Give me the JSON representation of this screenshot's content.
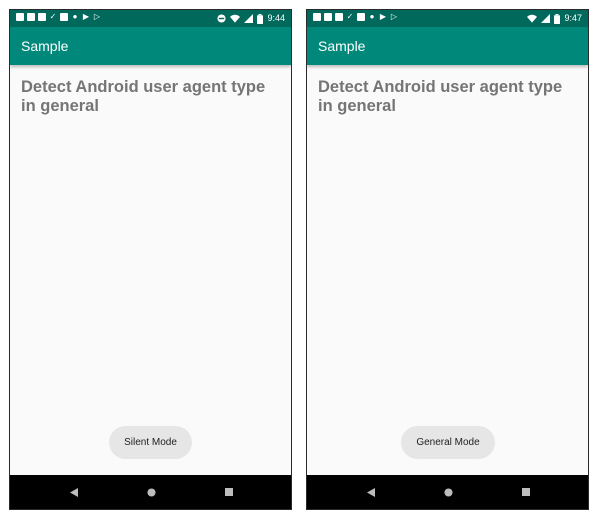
{
  "screens": [
    {
      "status": {
        "time": "9:44"
      },
      "app_bar": {
        "title": "Sample"
      },
      "content": {
        "text": "Detect Android user agent type in general"
      },
      "toast": {
        "text": "Silent Mode"
      }
    },
    {
      "status": {
        "time": "9:47"
      },
      "app_bar": {
        "title": "Sample"
      },
      "content": {
        "text": "Detect Android user agent type in general"
      },
      "toast": {
        "text": "General Mode"
      }
    }
  ],
  "colors": {
    "status_bar": "#00695c",
    "app_bar": "#00897b",
    "background": "#fafafa",
    "text_gray": "#757575",
    "toast_bg": "#e6e6e6",
    "nav_bar": "#000000"
  },
  "icons": {
    "status_left_screen1": [
      "notification-icon",
      "youtube-icon",
      "youtube-icon",
      "download-done-icon",
      "calendar-icon",
      "circle-icon",
      "signal-play-icon",
      "play-store-icon"
    ],
    "status_right_screen1": [
      "do-not-disturb-icon",
      "wifi-icon",
      "cell-signal-icon",
      "battery-icon"
    ],
    "status_left_screen2": [
      "notification-icon",
      "youtube-icon",
      "youtube-icon",
      "download-done-icon",
      "calendar-icon",
      "circle-icon",
      "signal-play-icon",
      "play-store-icon"
    ],
    "status_right_screen2": [
      "wifi-icon",
      "cell-signal-icon",
      "battery-icon"
    ],
    "nav": [
      "back-icon",
      "home-icon",
      "recents-icon"
    ]
  }
}
